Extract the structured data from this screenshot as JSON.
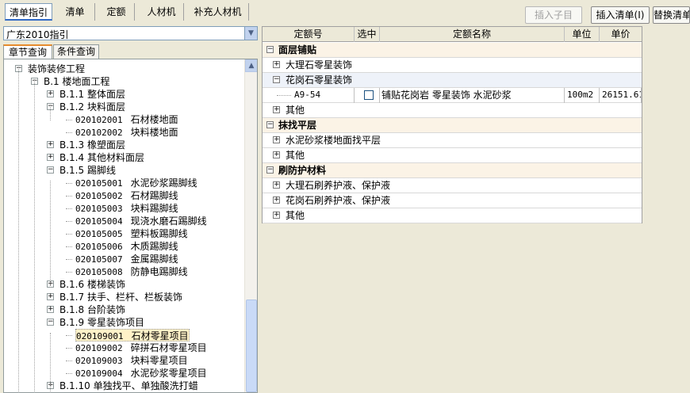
{
  "tabs": [
    {
      "label": "清单指引",
      "active": true
    },
    {
      "label": "清单"
    },
    {
      "label": "定额"
    },
    {
      "label": "人材机"
    },
    {
      "label": "补充人材机"
    }
  ],
  "buttons": {
    "insert_child": "插入子目",
    "insert_list": "插入清单(I)",
    "replace_list": "替换清单"
  },
  "combo": {
    "value": "广东2010指引"
  },
  "subtabs": [
    "章节查询",
    "条件查询"
  ],
  "tree": [
    {
      "label": "装饰装修工程",
      "level": 0,
      "state": "-"
    },
    {
      "label": "B.1 楼地面工程",
      "level": 1,
      "state": "-"
    },
    {
      "label": "B.1.1 整体面层",
      "level": 2,
      "state": "+"
    },
    {
      "label": "B.1.2 块料面层",
      "level": 2,
      "state": "-"
    },
    {
      "code": "020102001",
      "label": "石材楼地面",
      "level": 3
    },
    {
      "code": "020102002",
      "label": "块料楼地面",
      "level": 3
    },
    {
      "label": "B.1.3 橡塑面层",
      "level": 2,
      "state": "+"
    },
    {
      "label": "B.1.4 其他材料面层",
      "level": 2,
      "state": "+"
    },
    {
      "label": "B.1.5 踢脚线",
      "level": 2,
      "state": "-"
    },
    {
      "code": "020105001",
      "label": "水泥砂浆踢脚线",
      "level": 3
    },
    {
      "code": "020105002",
      "label": "石材踢脚线",
      "level": 3
    },
    {
      "code": "020105003",
      "label": "块料踢脚线",
      "level": 3
    },
    {
      "code": "020105004",
      "label": "现浇水磨石踢脚线",
      "level": 3
    },
    {
      "code": "020105005",
      "label": "塑料板踢脚线",
      "level": 3
    },
    {
      "code": "020105006",
      "label": "木质踢脚线",
      "level": 3
    },
    {
      "code": "020105007",
      "label": "金属踢脚线",
      "level": 3
    },
    {
      "code": "020105008",
      "label": "防静电踢脚线",
      "level": 3
    },
    {
      "label": "B.1.6 楼梯装饰",
      "level": 2,
      "state": "+"
    },
    {
      "label": "B.1.7 扶手、栏杆、栏板装饰",
      "level": 2,
      "state": "+"
    },
    {
      "label": "B.1.8 台阶装饰",
      "level": 2,
      "state": "+"
    },
    {
      "label": "B.1.9 零星装饰项目",
      "level": 2,
      "state": "-"
    },
    {
      "code": "020109001",
      "label": "石材零星项目",
      "level": 3,
      "selected": true
    },
    {
      "code": "020109002",
      "label": "碎拼石材零星项目",
      "level": 3
    },
    {
      "code": "020109003",
      "label": "块料零星项目",
      "level": 3
    },
    {
      "code": "020109004",
      "label": "水泥砂浆零星项目",
      "level": 3
    },
    {
      "label": "B.1.10 单独找平、单独酸洗打蜡",
      "level": 2,
      "state": "+"
    }
  ],
  "grid": {
    "headers": [
      "定额号",
      "选中",
      "定额名称",
      "单位",
      "单价"
    ],
    "rows": [
      {
        "type": "group",
        "state": "-",
        "label": "面层铺贴"
      },
      {
        "type": "sub",
        "state": "+",
        "label": "大理石零星装饰"
      },
      {
        "type": "sub",
        "state": "-",
        "label": "花岗石零星装饰",
        "active": true
      },
      {
        "type": "item",
        "code": "A9-54",
        "name": "铺贴花岗岩 零星装饰 水泥砂浆",
        "unit": "100m2",
        "price": "26151.61"
      },
      {
        "type": "sub",
        "state": "+",
        "label": "其他"
      },
      {
        "type": "group",
        "state": "-",
        "label": "抹找平层"
      },
      {
        "type": "sub",
        "state": "+",
        "label": "水泥砂浆楼地面找平层"
      },
      {
        "type": "sub",
        "state": "+",
        "label": "其他"
      },
      {
        "type": "group",
        "state": "-",
        "label": "刷防护材料"
      },
      {
        "type": "sub",
        "state": "+",
        "label": "大理石刷养护液、保护液"
      },
      {
        "type": "sub",
        "state": "+",
        "label": "花岗石刷养护液、保护液"
      },
      {
        "type": "sub",
        "state": "+",
        "label": "其他"
      }
    ]
  }
}
